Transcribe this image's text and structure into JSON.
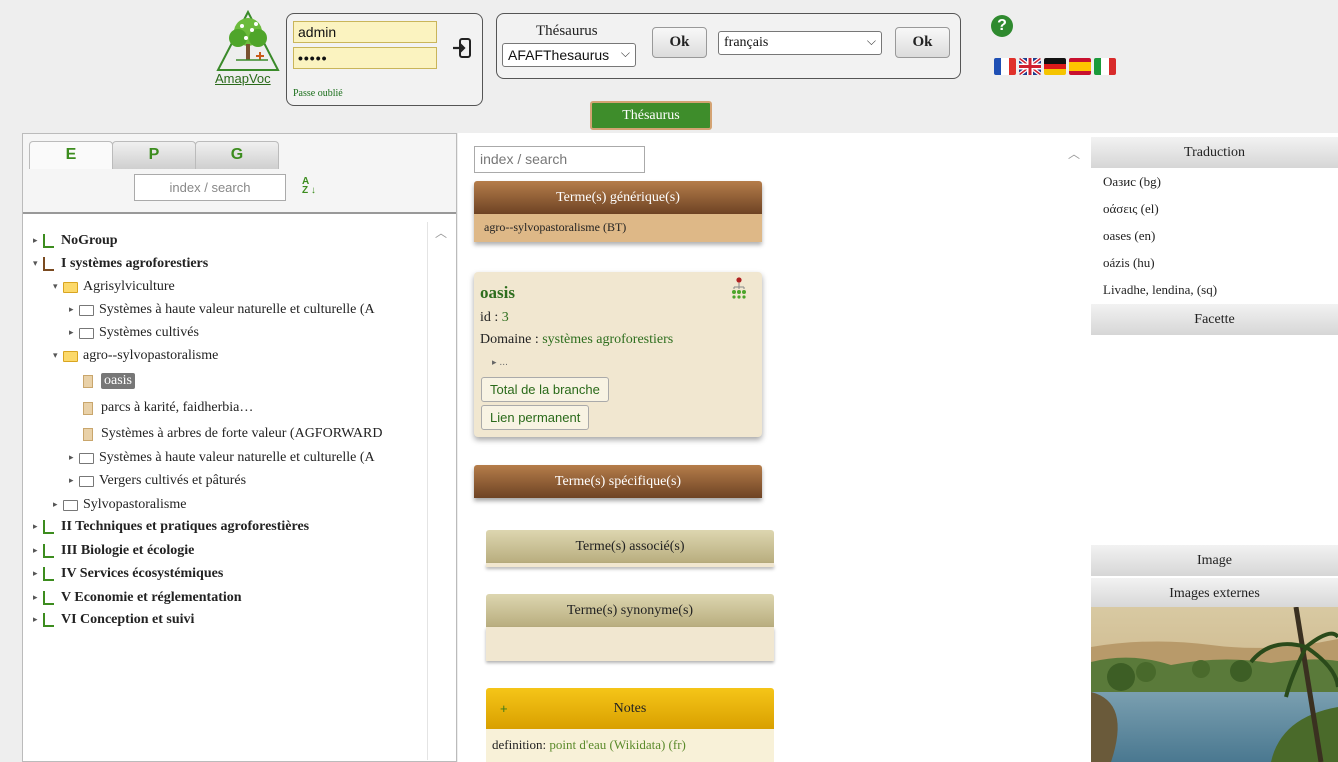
{
  "header": {
    "logo_text": "AmapVoc",
    "login": {
      "username_value": "admin",
      "password_value": "•••••",
      "forgot_label": "Passe oublié"
    },
    "thesaurus_box": {
      "label": "Thésaurus",
      "thesaurus_select": "AFAFThesaurus",
      "ok_label": "Ok",
      "language_select": "français",
      "ok2_label": "Ok"
    },
    "help_label": "?",
    "flags": [
      "fr",
      "en",
      "de",
      "es",
      "it"
    ],
    "active_tab": "Thésaurus"
  },
  "left": {
    "tabs": [
      "E",
      "P",
      "G"
    ],
    "search_placeholder": "index / search",
    "tree": [
      {
        "label": "NoGroup"
      },
      {
        "label": "I systèmes agroforestiers"
      },
      {
        "label": "Agrisylviculture"
      },
      {
        "label": "Systèmes à haute valeur naturelle et culturelle (A"
      },
      {
        "label": "Systèmes cultivés"
      },
      {
        "label": "agro--sylvopastoralisme"
      },
      {
        "label": "oasis"
      },
      {
        "label": "parcs à karité, faidherbia…"
      },
      {
        "label": "Systèmes à arbres de forte valeur (AGFORWARD"
      },
      {
        "label": "Systèmes à haute valeur naturelle et culturelle (A"
      },
      {
        "label": "Vergers cultivés et pâturés"
      },
      {
        "label": "Sylvopastoralisme"
      },
      {
        "label": "II Techniques et pratiques agroforestières"
      },
      {
        "label": "III Biologie et écologie"
      },
      {
        "label": "IV Services écosystémiques"
      },
      {
        "label": "V Economie et réglementation"
      },
      {
        "label": "VI Conception et suivi"
      }
    ]
  },
  "center": {
    "search_placeholder": "index / search",
    "broader_header": "Terme(s) générique(s)",
    "broader_term": "agro--sylvopastoralisme (BT)",
    "term": {
      "name": "oasis",
      "id_label": "id :",
      "id_value": "3",
      "domain_label": "Domaine :",
      "domain_value": "systèmes agroforestiers",
      "more": "▸ ...",
      "branch_button": "Total de la branche",
      "permalink_button": "Lien permanent"
    },
    "narrower_header": "Terme(s) spécifique(s)",
    "related_header": "Terme(s) associé(s)",
    "synonym_header": "Terme(s) synonyme(s)",
    "notes_header": "Notes",
    "notes_plus": "+",
    "notes": {
      "label": "definition:",
      "value": "point d'eau (Wikidata) (fr)"
    }
  },
  "right": {
    "translation_header": "Traduction",
    "translations": [
      "Оазис (bg)",
      "οάσεις (el)",
      "oases (en)",
      "oázis (hu)",
      "Livadhe, lendina, (sq)"
    ],
    "facet_header": "Facette",
    "image_header": "Image",
    "external_images_header": "Images externes"
  },
  "colors": {
    "brand_green": "#3e8d2b",
    "brown_header": "#8b5a2b",
    "notes_yellow": "#f5c518",
    "khaki_header": "#c9bf8f"
  }
}
